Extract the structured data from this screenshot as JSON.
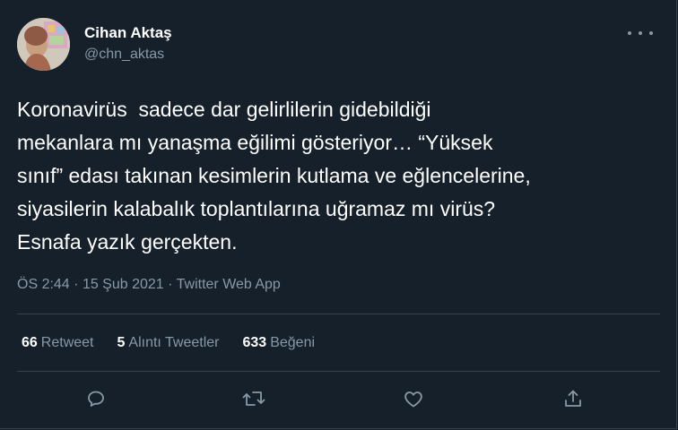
{
  "author": {
    "name": "Cihan Aktaş",
    "handle": "@chn_aktas"
  },
  "tweet": {
    "text": "Koronavirüs  sadece dar gelirlilerin gidebildiği\nmekanlara mı yanaşma eğilimi gösteriyor… “Yüksek\nsınıf” edası takınan kesimlerin kutlama ve eğlencelerine,\nsiyasilerin kalabalık toplantılarına uğramaz mı virüs?\nEsnafa yazık gerçekten.",
    "time": "ÖS 2:44",
    "date": "15 Şub 2021",
    "source": "Twitter Web App",
    "separator": "·"
  },
  "stats": {
    "retweets_count": "66",
    "retweets_label": "Retweet",
    "quotes_count": "5",
    "quotes_label": "Alıntı Tweetler",
    "likes_count": "633",
    "likes_label": "Beğeni"
  },
  "actions": [
    "reply-icon",
    "retweet-icon",
    "like-icon",
    "share-icon"
  ],
  "colors": {
    "background": "#15202b",
    "secondary_text": "#8899a6",
    "divider": "#38444d",
    "primary_text": "#ffffff"
  }
}
